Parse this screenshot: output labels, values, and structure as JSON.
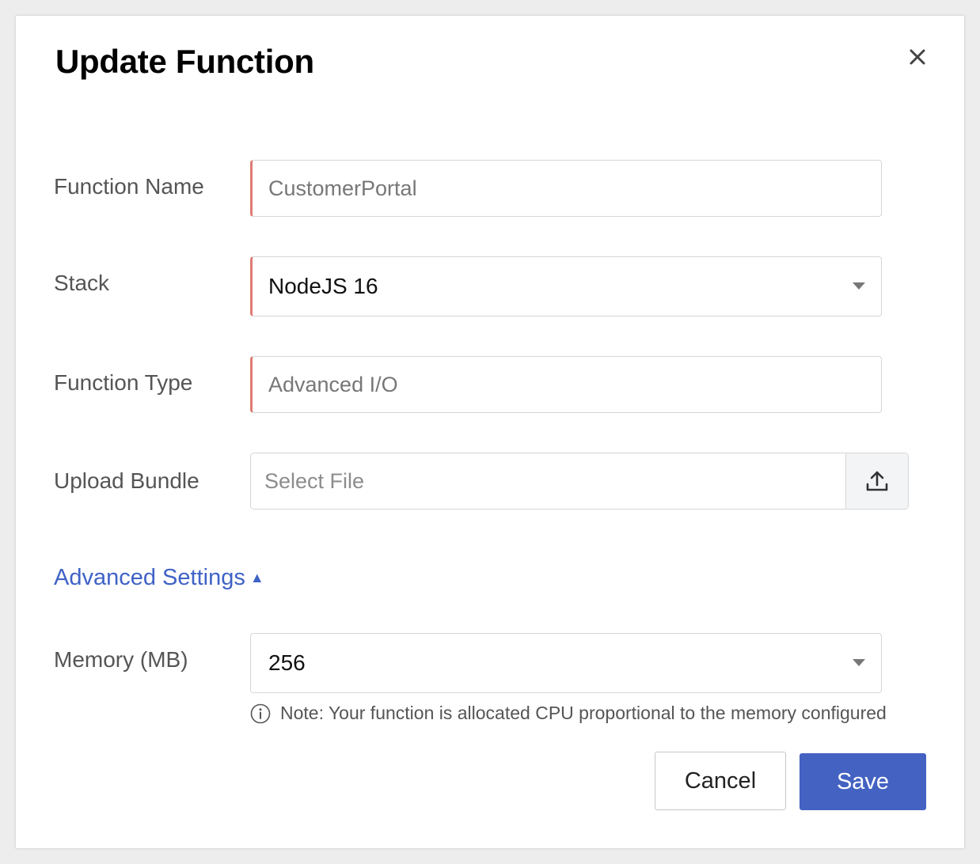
{
  "dialog": {
    "title": "Update Function",
    "close_icon": "close-icon"
  },
  "fields": {
    "function_name": {
      "label": "Function Name",
      "value": "CustomerPortal"
    },
    "stack": {
      "label": "Stack",
      "value": "NodeJS 16"
    },
    "function_type": {
      "label": "Function Type",
      "value": "Advanced I/O"
    },
    "upload_bundle": {
      "label": "Upload Bundle",
      "placeholder": "Select File",
      "icon": "upload-icon"
    }
  },
  "advanced": {
    "toggle_label": "Advanced Settings",
    "toggle_indicator": "▲",
    "memory": {
      "label": "Memory (MB)",
      "value": "256"
    },
    "note": "Note: Your function is allocated CPU proportional to the memory configured"
  },
  "actions": {
    "cancel_label": "Cancel",
    "save_label": "Save"
  },
  "colors": {
    "accent": "#4462c2",
    "link": "#3f62c6",
    "required_marker": "#e07b74"
  }
}
